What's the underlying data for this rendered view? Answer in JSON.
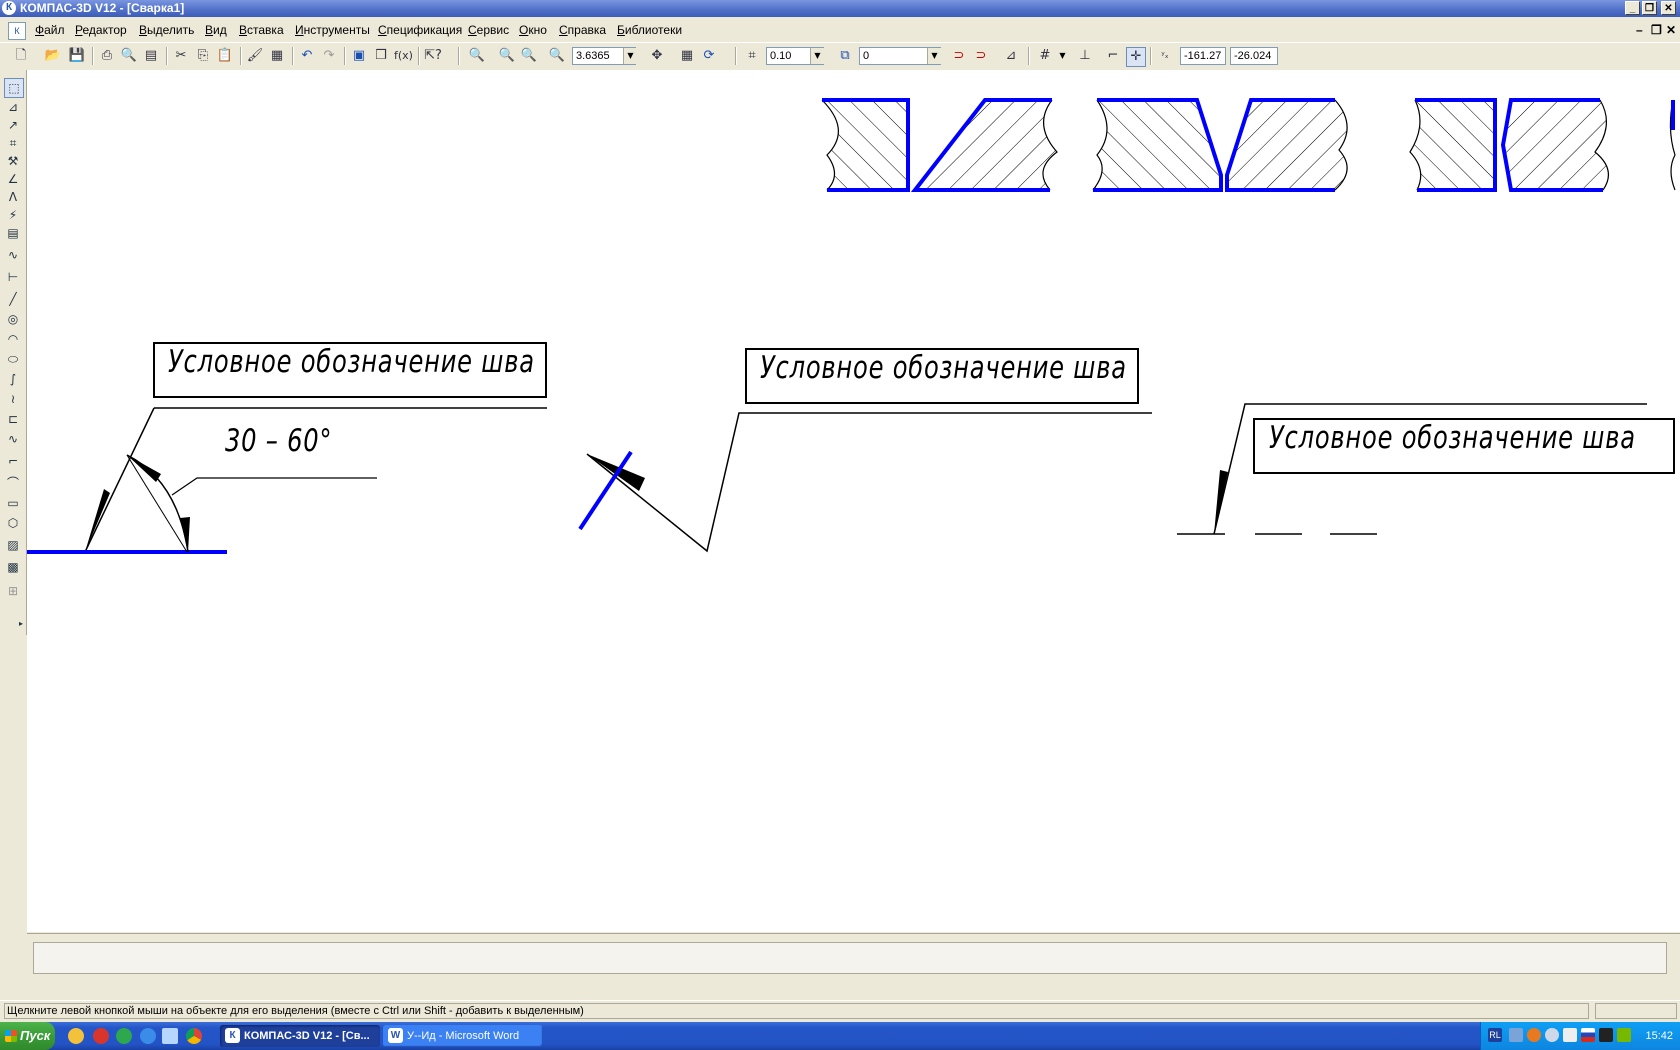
{
  "window": {
    "title": "КОМПАС-3D V12 - [Сварка1]",
    "app_icon": "К"
  },
  "menu": [
    "Файл",
    "Редактор",
    "Выделить",
    "Вид",
    "Вставка",
    "Инструменты",
    "Спецификация",
    "Сервис",
    "Окно",
    "Справка",
    "Библиотеки"
  ],
  "toolbar": {
    "zoom": "3.6365",
    "step": "0.10",
    "layer": "0",
    "coord_x": "-161.27",
    "coord_y": "-26.024"
  },
  "drawing": {
    "annotation_1": "Условное обозначение шва",
    "annotation_2": "Условное обозначение шва",
    "annotation_3": "Условное обозначение шва",
    "angle_label": "30 – 60°",
    "contour_color": "#0000ff"
  },
  "status": {
    "message": "Щелкните левой кнопкой мыши на объекте для его выделения (вместе с Ctrl или Shift - добавить к выделенным)"
  },
  "taskbar": {
    "start_label": "Пуск",
    "tasks": [
      {
        "label": "КОМПАС-3D V12 - [Св...",
        "icon": "К"
      },
      {
        "label": "У--Ид - Microsoft Word",
        "icon": "W"
      }
    ],
    "lang": "RL",
    "clock": "15:42"
  }
}
